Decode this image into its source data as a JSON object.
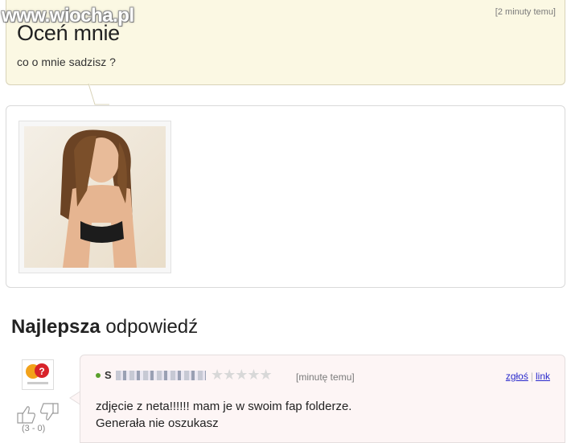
{
  "watermark": "www.wiocha.pl",
  "question": {
    "time": "[2 minuty temu]",
    "title": "Oceń mnie",
    "subtitle": "co o mnie sadzisz ?"
  },
  "best_answer": {
    "heading_bold": "Najlepsza",
    "heading_rest": "odpowiedź",
    "author_initial": "S",
    "rating_stars": "★★★★★",
    "time": "[minutę temu]",
    "report_label": "zgłoś",
    "link_label": "link",
    "text_line1": "zdjęcie z neta!!!!!! mam je w swoim fap folderze.",
    "text_line2": "Generała nie oszukasz",
    "votes": "(3 - 0)"
  },
  "colors": {
    "question_bg": "#fbf8e3",
    "answer_bg": "#fdf5f5",
    "link": "#2a2acc"
  }
}
